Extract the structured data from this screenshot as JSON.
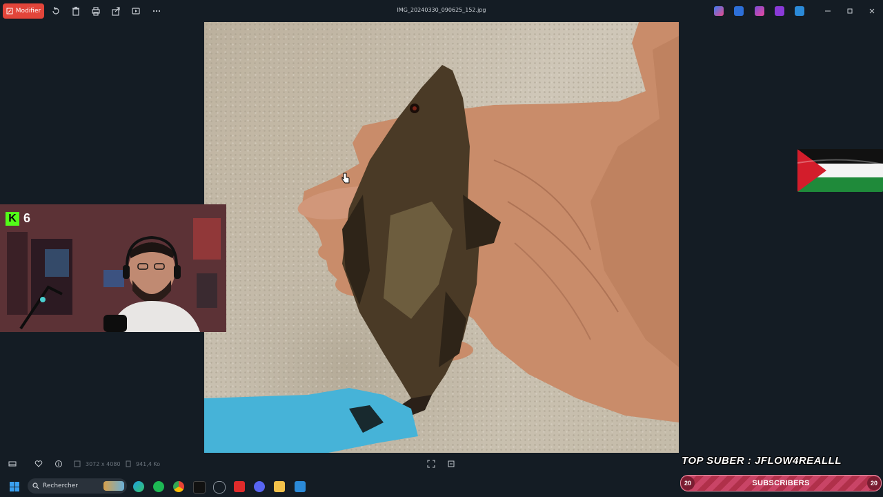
{
  "toolbar": {
    "edit_label": "Modifier",
    "file_title": "IMG_20240330_090625_152.jpg"
  },
  "webcam": {
    "kick_logo": "K",
    "viewer_count": "6"
  },
  "statusbar": {
    "dimensions": "3072 x 4080",
    "file_size": "941,4 Ko"
  },
  "overlay": {
    "top_suber": "TOP SUBER : JFLOW4REALLL",
    "sub_left": "20",
    "sub_label": "SUBSCRIBERS",
    "sub_right": "20"
  },
  "taskbar": {
    "search_label": "Rechercher"
  },
  "colors": {
    "edit_button": "#e2453a",
    "background": "#141c24",
    "kick_green": "#53fc18",
    "sub_bar": "#b0304a"
  }
}
